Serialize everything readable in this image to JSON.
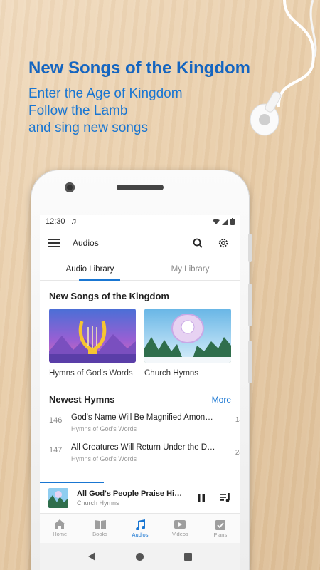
{
  "promo": {
    "headline": "New Songs of the Kingdom",
    "lines": [
      "Enter the Age of Kingdom",
      "Follow the Lamb",
      "and sing new songs"
    ]
  },
  "status_bar": {
    "time": "12:30"
  },
  "app_bar": {
    "title": "Audios",
    "menu_icon": "hamburger-menu-icon",
    "search_icon": "search-icon",
    "settings_icon": "gear-icon"
  },
  "tabs": [
    {
      "label": "Audio Library",
      "active": true
    },
    {
      "label": "My Library",
      "active": false
    }
  ],
  "featured": {
    "title": "New Songs of the Kingdom",
    "albums": [
      {
        "label": "Hymns of God's Words",
        "art_icon": "lyre-icon"
      },
      {
        "label": "Church Hymns",
        "art_icon": "guitar-icon"
      }
    ]
  },
  "newest": {
    "title": "Newest Hymns",
    "more_label": "More",
    "items": [
      {
        "number": "146",
        "title": "God's Name Will Be Magnified Amon…",
        "subtitle": "Hymns of God's Words",
        "edge": "14"
      },
      {
        "number": "147",
        "title": "All Creatures Will Return Under the D…",
        "subtitle": "Hymns of God's Words",
        "edge": "24"
      }
    ]
  },
  "player": {
    "title": "All God's People Praise Him t…",
    "subtitle": "Church Hymns",
    "progress": 0.32
  },
  "bottom_nav": [
    {
      "label": "Home",
      "icon": "home-icon",
      "active": false
    },
    {
      "label": "Books",
      "icon": "book-icon",
      "active": false
    },
    {
      "label": "Audios",
      "icon": "music-note-icon",
      "active": true
    },
    {
      "label": "Videos",
      "icon": "video-icon",
      "active": false
    },
    {
      "label": "Plans",
      "icon": "checklist-icon",
      "active": false
    }
  ],
  "colors": {
    "accent": "#1976d2",
    "headline": "#1565c0"
  }
}
